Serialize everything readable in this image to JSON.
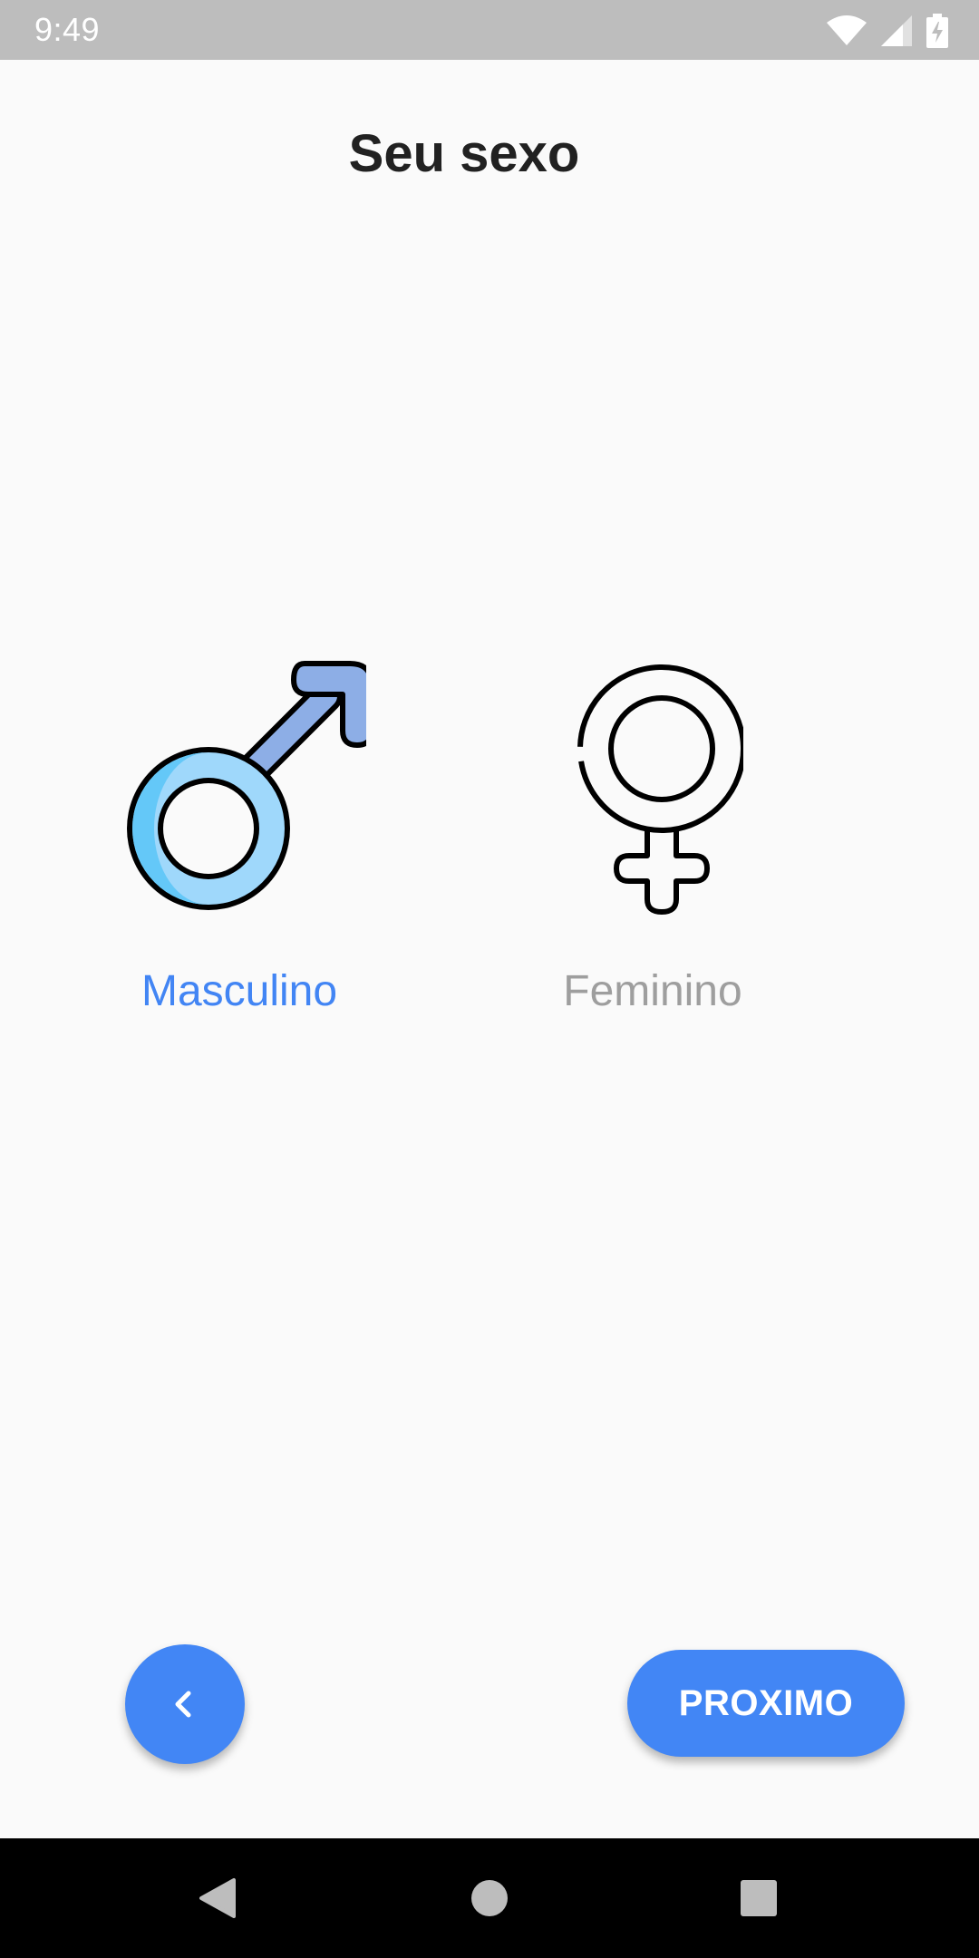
{
  "status_bar": {
    "time": "9:49",
    "icons": [
      "wifi-icon",
      "cell-signal-icon",
      "battery-charging-icon"
    ]
  },
  "page": {
    "title": "Seu sexo"
  },
  "options": {
    "male_label": "Masculino",
    "female_label": "Feminino",
    "selected": "Masculino"
  },
  "buttons": {
    "next_label": "PROXIMO",
    "back_icon": "chevron-left-icon"
  },
  "nav_bar": {
    "icons": [
      "back-triangle-icon",
      "home-circle-icon",
      "recents-square-icon"
    ]
  },
  "colors": {
    "accent": "#4285f4",
    "inactive": "#9e9e9e",
    "title": "#212121",
    "background": "#fafafa"
  }
}
